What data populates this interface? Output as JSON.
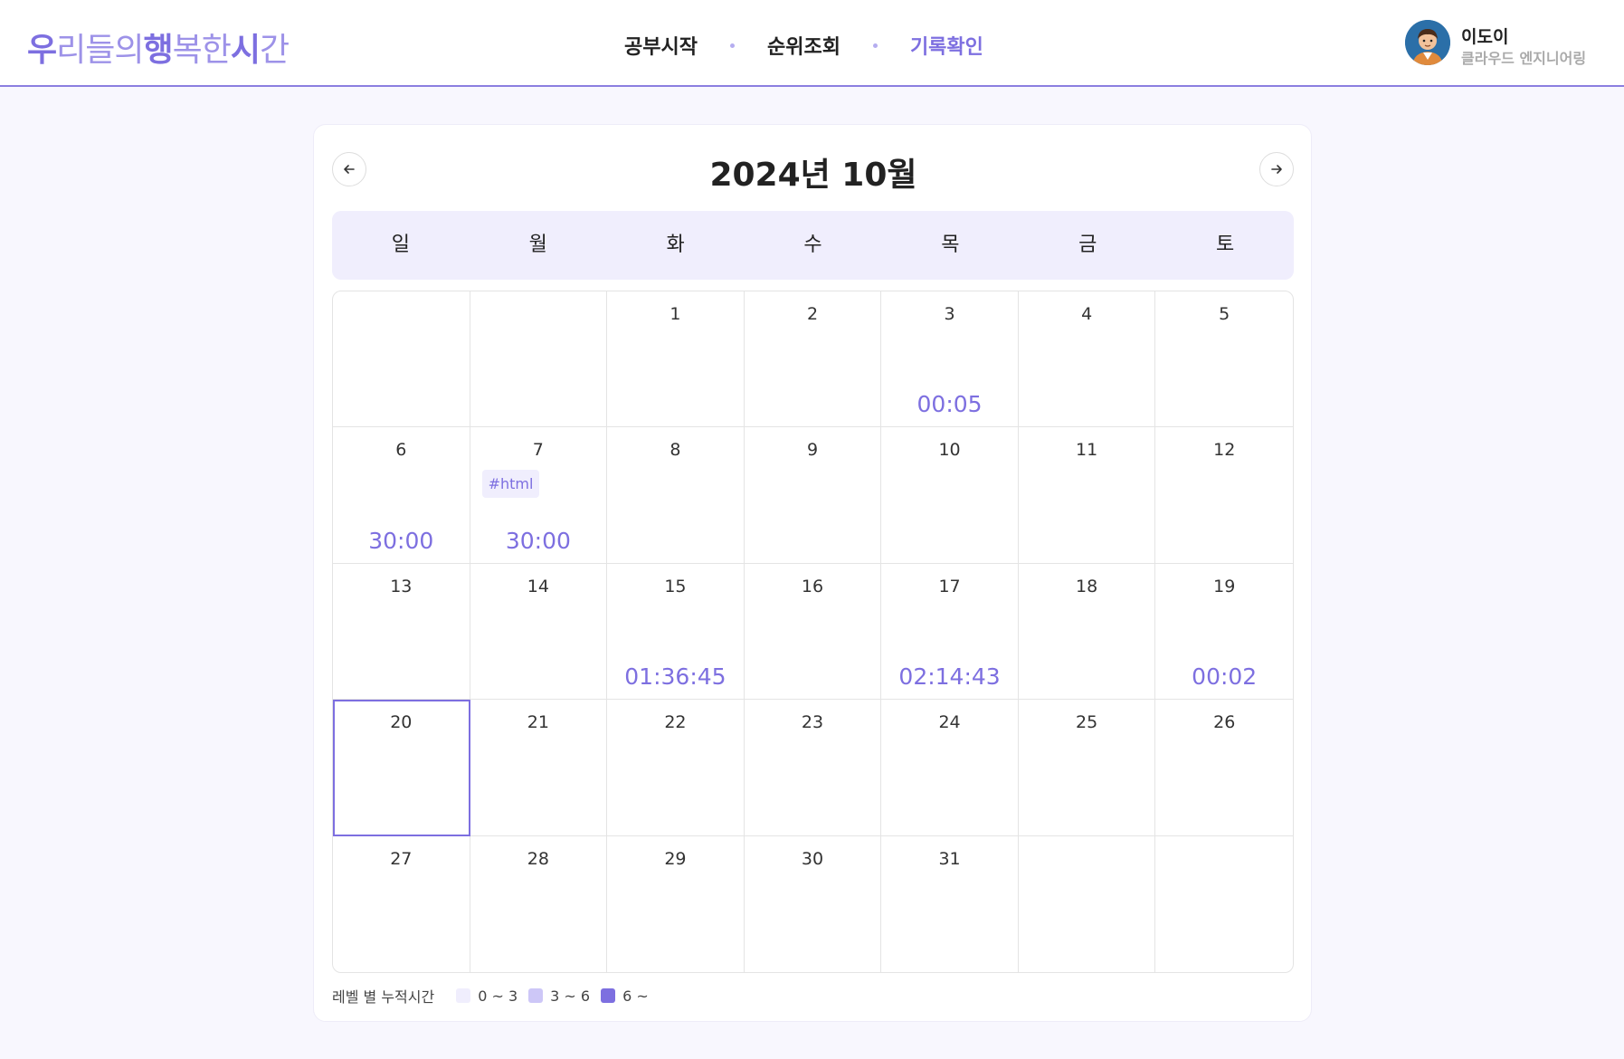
{
  "header": {
    "logo_parts": [
      "우",
      "리들의",
      "행",
      "복한",
      "시",
      "간"
    ],
    "nav": [
      {
        "label": "공부시작",
        "active": false
      },
      {
        "label": "순위조회",
        "active": false
      },
      {
        "label": "기록확인",
        "active": true
      }
    ],
    "user": {
      "name": "이도이",
      "org": "클라우드 엔지니어링",
      "avatar_icon": "avatar-icon"
    }
  },
  "calendar": {
    "title": "2024년 10월",
    "prev_icon": "arrow-left-icon",
    "next_icon": "arrow-right-icon",
    "weekdays": [
      "일",
      "월",
      "화",
      "수",
      "목",
      "금",
      "토"
    ],
    "today": "20",
    "cells": [
      {
        "day": "",
        "time": "",
        "tag": ""
      },
      {
        "day": "",
        "time": "",
        "tag": ""
      },
      {
        "day": "1",
        "time": "",
        "tag": ""
      },
      {
        "day": "2",
        "time": "",
        "tag": ""
      },
      {
        "day": "3",
        "time": "00:05",
        "tag": ""
      },
      {
        "day": "4",
        "time": "",
        "tag": ""
      },
      {
        "day": "5",
        "time": "",
        "tag": ""
      },
      {
        "day": "6",
        "time": "30:00",
        "tag": ""
      },
      {
        "day": "7",
        "time": "30:00",
        "tag": "#html"
      },
      {
        "day": "8",
        "time": "",
        "tag": ""
      },
      {
        "day": "9",
        "time": "",
        "tag": ""
      },
      {
        "day": "10",
        "time": "",
        "tag": ""
      },
      {
        "day": "11",
        "time": "",
        "tag": ""
      },
      {
        "day": "12",
        "time": "",
        "tag": ""
      },
      {
        "day": "13",
        "time": "",
        "tag": ""
      },
      {
        "day": "14",
        "time": "",
        "tag": ""
      },
      {
        "day": "15",
        "time": "01:36:45",
        "tag": ""
      },
      {
        "day": "16",
        "time": "",
        "tag": ""
      },
      {
        "day": "17",
        "time": "02:14:43",
        "tag": ""
      },
      {
        "day": "18",
        "time": "",
        "tag": ""
      },
      {
        "day": "19",
        "time": "00:02",
        "tag": ""
      },
      {
        "day": "20",
        "time": "",
        "tag": ""
      },
      {
        "day": "21",
        "time": "",
        "tag": ""
      },
      {
        "day": "22",
        "time": "",
        "tag": ""
      },
      {
        "day": "23",
        "time": "",
        "tag": ""
      },
      {
        "day": "24",
        "time": "",
        "tag": ""
      },
      {
        "day": "25",
        "time": "",
        "tag": ""
      },
      {
        "day": "26",
        "time": "",
        "tag": ""
      },
      {
        "day": "27",
        "time": "",
        "tag": ""
      },
      {
        "day": "28",
        "time": "",
        "tag": ""
      },
      {
        "day": "29",
        "time": "",
        "tag": ""
      },
      {
        "day": "30",
        "time": "",
        "tag": ""
      },
      {
        "day": "31",
        "time": "",
        "tag": ""
      },
      {
        "day": "",
        "time": "",
        "tag": ""
      },
      {
        "day": "",
        "time": "",
        "tag": ""
      }
    ]
  },
  "legend": {
    "label": "레벨 별 누적시간",
    "items": [
      {
        "range": "0 ~ 3",
        "color": "#f0eefd"
      },
      {
        "range": "3 ~ 6",
        "color": "#cdc7f7"
      },
      {
        "range": "6 ~",
        "color": "#7d6fe0"
      }
    ]
  },
  "colors": {
    "accent": "#7d6fe0",
    "header_border": "#8b7ee0",
    "background": "#f8f7fe"
  }
}
